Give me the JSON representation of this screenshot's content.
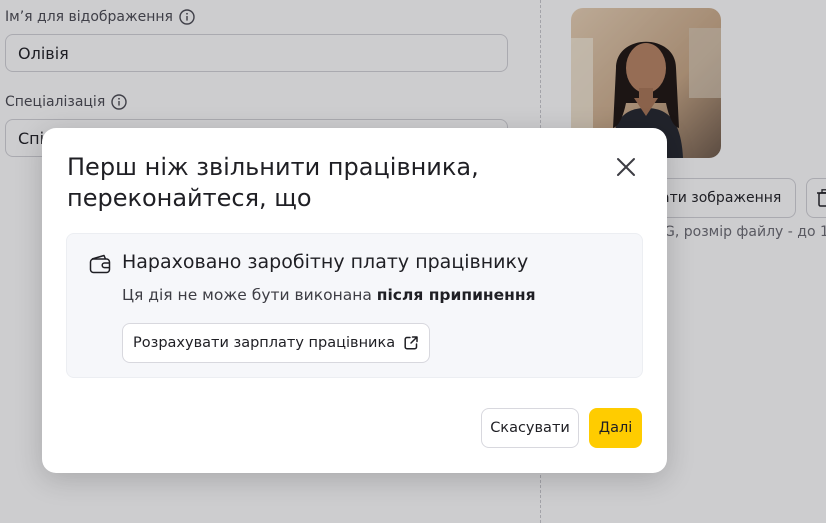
{
  "form": {
    "display_name_label": "Ім’я для відображення",
    "display_name_value": "Олівія",
    "specialization_label": "Спеціалізація",
    "specialization_value": "Спі",
    "upload_image_button": "ати зображення",
    "file_hint": "G, розмір файлу - до 1"
  },
  "modal": {
    "title": "Перш ніж звільнити працівника, переконайтеся, що",
    "card": {
      "icon": "wallet-icon",
      "title": "Нараховано заробітну плату працівнику",
      "desc_prefix": "Ця дія не може бути виконана",
      "desc_emphasis": "після припинення",
      "link_label": "Розрахувати зарплату працівника",
      "link_icon": "external-link-icon"
    },
    "cancel_label": "Скасувати",
    "next_label": "Далі"
  },
  "colors": {
    "primary_button": "#ffcc00",
    "overlay": "rgba(26,27,38,0.22)"
  }
}
